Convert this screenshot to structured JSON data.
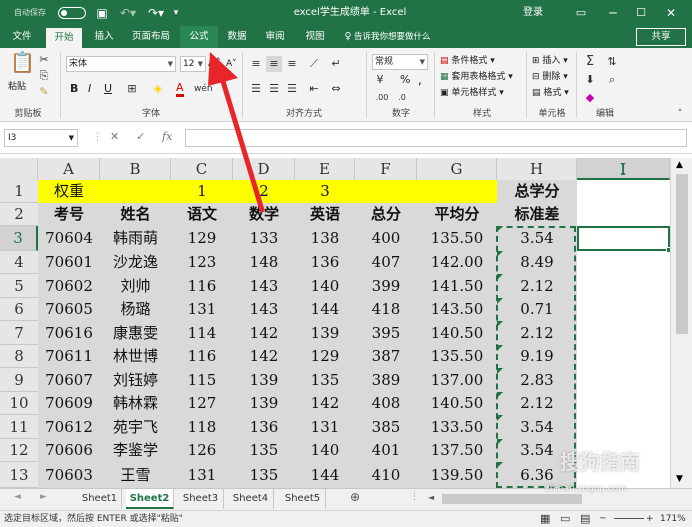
{
  "titlebar": {
    "autosave": "自动保存",
    "autosave_state": "关",
    "title": "excel学生成绩单 - Excel",
    "login": "登录"
  },
  "menus": [
    "文件",
    "开始",
    "插入",
    "页面布局",
    "公式",
    "数据",
    "审阅",
    "视图"
  ],
  "tell_me": "告诉我你想要做什么",
  "share": "共享",
  "ribbon": {
    "paste": "粘贴",
    "clipboard": "剪贴板",
    "font_name": "宋体",
    "font_size": "12",
    "font_group": "字体",
    "align_group": "对齐方式",
    "number_format": "常规",
    "number_group": "数字",
    "cond_format": "条件格式",
    "table_format": "套用表格格式",
    "cell_style": "单元格样式",
    "style_group": "样式",
    "insert": "插入",
    "delete": "删除",
    "format": "格式",
    "cells_group": "单元格",
    "edit_group": "编辑",
    "bold": "B",
    "italic": "I",
    "underline": "U",
    "grow": "A",
    "shrink": "A",
    "font_color": "A",
    "percent": "%",
    "comma": ","
  },
  "formula": {
    "namebox": "I3",
    "cancel": "✕",
    "confirm": "✓",
    "fx": "fx",
    "value": ""
  },
  "columns": [
    "A",
    "B",
    "C",
    "D",
    "E",
    "F",
    "G",
    "H",
    "I"
  ],
  "rows": [
    "1",
    "2",
    "3",
    "4",
    "5",
    "6",
    "7",
    "8",
    "9",
    "10",
    "11",
    "12",
    "13"
  ],
  "row1": {
    "a": "权重",
    "c": "1",
    "d": "2",
    "e": "3",
    "h": "总学分"
  },
  "headers": [
    "考号",
    "姓名",
    "语文",
    "数学",
    "英语",
    "总分",
    "平均分",
    "标准差"
  ],
  "data": [
    [
      "70604",
      "韩雨萌",
      "129",
      "133",
      "138",
      "400",
      "135.50",
      "3.54"
    ],
    [
      "70601",
      "沙龙逸",
      "123",
      "148",
      "136",
      "407",
      "142.00",
      "8.49"
    ],
    [
      "70602",
      "刘帅",
      "116",
      "143",
      "140",
      "399",
      "141.50",
      "2.12"
    ],
    [
      "70605",
      "杨璐",
      "131",
      "143",
      "144",
      "418",
      "143.50",
      "0.71"
    ],
    [
      "70616",
      "康惠雯",
      "114",
      "142",
      "139",
      "395",
      "140.50",
      "2.12"
    ],
    [
      "70611",
      "林世博",
      "116",
      "142",
      "129",
      "387",
      "135.50",
      "9.19"
    ],
    [
      "70607",
      "刘钰婷",
      "115",
      "139",
      "135",
      "389",
      "137.00",
      "2.83"
    ],
    [
      "70609",
      "韩林霖",
      "127",
      "139",
      "142",
      "408",
      "140.50",
      "2.12"
    ],
    [
      "70612",
      "苑宇飞",
      "118",
      "136",
      "131",
      "385",
      "133.50",
      "3.54"
    ],
    [
      "70606",
      "李鉴学",
      "126",
      "135",
      "140",
      "401",
      "137.50",
      "3.54"
    ],
    [
      "70603",
      "王雪",
      "131",
      "135",
      "144",
      "410",
      "139.50",
      "6.36"
    ]
  ],
  "sheets": [
    "Sheet1",
    "Sheet2",
    "Sheet3",
    "Sheet4",
    "Sheet5"
  ],
  "status": {
    "message": "选定目标区域，然后按 ENTER 或选择\"粘贴\"",
    "zoom": "171%"
  },
  "watermark": {
    "text": "搜狗指南",
    "url": "zhinan.sogou.com"
  },
  "colors": {
    "excel_green": "#217346",
    "highlight_yellow": "#ffff00",
    "selection_gray": "#d9d9d9",
    "arrow_red": "#e8262a"
  }
}
